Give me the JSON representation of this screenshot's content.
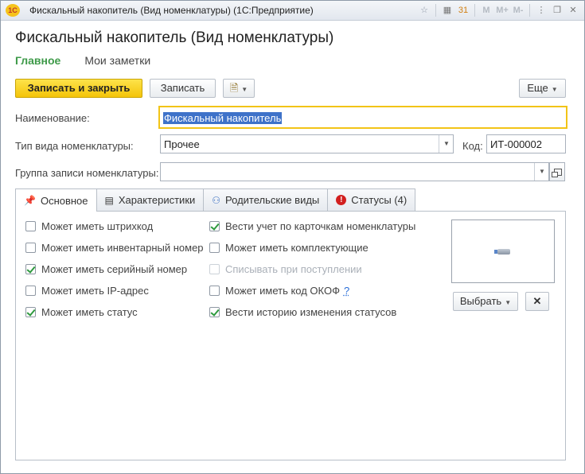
{
  "window": {
    "logo_text": "1С",
    "title": "Фискальный накопитель (Вид номенклатуры)  (1С:Предприятие)",
    "toolbar_m": "M",
    "toolbar_mplus": "M+",
    "toolbar_mminus": "M-",
    "toolbar_calendar_day": "31"
  },
  "page": {
    "title": "Фискальный накопитель (Вид номенклатуры)",
    "nav_tabs": [
      {
        "label": "Главное",
        "active": true
      },
      {
        "label": "Мои заметки",
        "active": false
      }
    ]
  },
  "commands": {
    "save_close": "Записать и закрыть",
    "save": "Записать",
    "more": "Еще"
  },
  "form": {
    "name_label": "Наименование:",
    "name_value": "Фискальный накопитель",
    "type_label": "Тип вида номенклатуры:",
    "type_value": "Прочее",
    "code_label": "Код:",
    "code_value": "ИТ-000002",
    "group_label": "Группа записи номенклатуры:",
    "group_value": ""
  },
  "tabs": [
    {
      "label": "Основное",
      "icon": "pin-icon",
      "active": true
    },
    {
      "label": "Характеристики",
      "icon": "list-icon",
      "active": false
    },
    {
      "label": "Родительские виды",
      "icon": "hierarchy-icon",
      "active": false
    },
    {
      "label": "Статусы (4)",
      "icon": "warning-icon",
      "active": false
    }
  ],
  "checkboxes_left": [
    {
      "label": "Может иметь штрихкод",
      "checked": false
    },
    {
      "label": "Может иметь инвентарный номер",
      "checked": false
    },
    {
      "label": "Может иметь серийный номер",
      "checked": true
    },
    {
      "label": "Может иметь IP-адрес",
      "checked": false
    },
    {
      "label": "Может иметь статус",
      "checked": true
    }
  ],
  "checkboxes_right": [
    {
      "label": "Вести учет по карточкам номенклатуры",
      "checked": true,
      "disabled": false
    },
    {
      "label": "Может иметь комплектующие",
      "checked": false,
      "disabled": false
    },
    {
      "label": "Списывать при поступлении",
      "checked": false,
      "disabled": true
    },
    {
      "label": "Может иметь код ОКОФ",
      "checked": false,
      "disabled": false,
      "help": "?"
    },
    {
      "label": "Вести историю изменения статусов",
      "checked": true,
      "disabled": false
    }
  ],
  "image": {
    "select_label": "Выбрать",
    "clear_label": "✕"
  },
  "colors": {
    "accent_green": "#3e9a49",
    "primary_button": "#f4c40a",
    "focus_border": "#f2c417",
    "check": "#2e9a3e"
  }
}
